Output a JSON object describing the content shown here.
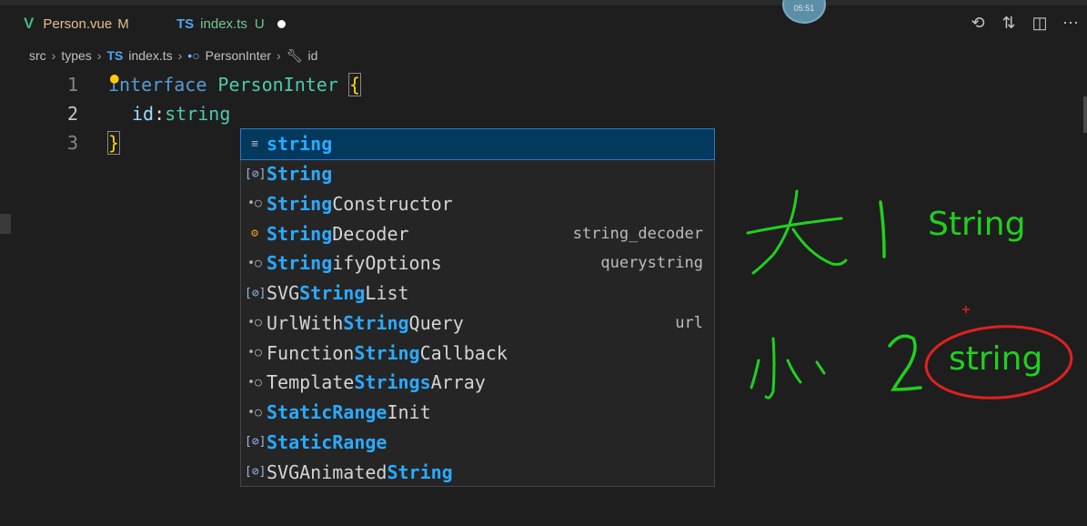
{
  "tabs": [
    {
      "icon": "V",
      "label": "Person.vue",
      "status": "M"
    },
    {
      "icon": "TS",
      "label": "index.ts",
      "status": "U"
    }
  ],
  "clock": {
    "time": "05:51"
  },
  "actions": [
    "history-icon",
    "compare-icon",
    "split-editor-icon",
    "more-icon"
  ],
  "breadcrumb": {
    "segments": [
      "src",
      "types",
      "index.ts",
      "PersonInter",
      "id"
    ],
    "file_icon": "TS"
  },
  "editor": {
    "lines": [
      {
        "number": "1",
        "tokens": {
          "keyword": "interface",
          "name": "PersonInter",
          "brace": "{"
        }
      },
      {
        "number": "2",
        "tokens": {
          "prop": "id",
          "colon": ":",
          "type": "string"
        }
      },
      {
        "number": "3",
        "tokens": {
          "brace": "}"
        }
      }
    ]
  },
  "suggestions": [
    {
      "icon": "keyword-icon",
      "pre": "",
      "match": "string",
      "post": "",
      "detail": ""
    },
    {
      "icon": "variable-icon",
      "pre": "",
      "match": "String",
      "post": "",
      "detail": ""
    },
    {
      "icon": "interface-icon",
      "pre": "",
      "match": "String",
      "post": "Constructor",
      "detail": ""
    },
    {
      "icon": "class-icon",
      "pre": "",
      "match": "String",
      "post": "Decoder",
      "detail": "string_decoder"
    },
    {
      "icon": "interface-icon",
      "pre": "",
      "match": "String",
      "post": "ifyOptions",
      "detail": "querystring"
    },
    {
      "icon": "variable-icon",
      "pre": "SVG",
      "match": "String",
      "post": "List",
      "detail": ""
    },
    {
      "icon": "interface-icon",
      "pre": "UrlWith",
      "match": "String",
      "post": "Query",
      "detail": "url"
    },
    {
      "icon": "interface-icon",
      "pre": "Function",
      "match": "String",
      "post": "Callback",
      "detail": ""
    },
    {
      "icon": "interface-icon",
      "pre": "Template",
      "match": "Strings",
      "post": "Array",
      "detail": ""
    },
    {
      "icon": "interface-icon",
      "pre": "",
      "match": "StaticRange",
      "post": "Init",
      "detail": ""
    },
    {
      "icon": "variable-icon",
      "pre": "",
      "match": "StaticRange",
      "post": "",
      "detail": ""
    },
    {
      "icon": "variable-icon",
      "pre": "SVGAnimated",
      "match": "String",
      "post": "",
      "detail": ""
    }
  ],
  "annotations": {
    "upper_text": "String",
    "lower_text": "string",
    "ink_color": "#20d020",
    "circle_color": "#e02020"
  },
  "colors": {
    "keyword": "#569cd6",
    "type": "#4ec9b0",
    "match": "#2aaaff",
    "selection": "#04395e"
  }
}
